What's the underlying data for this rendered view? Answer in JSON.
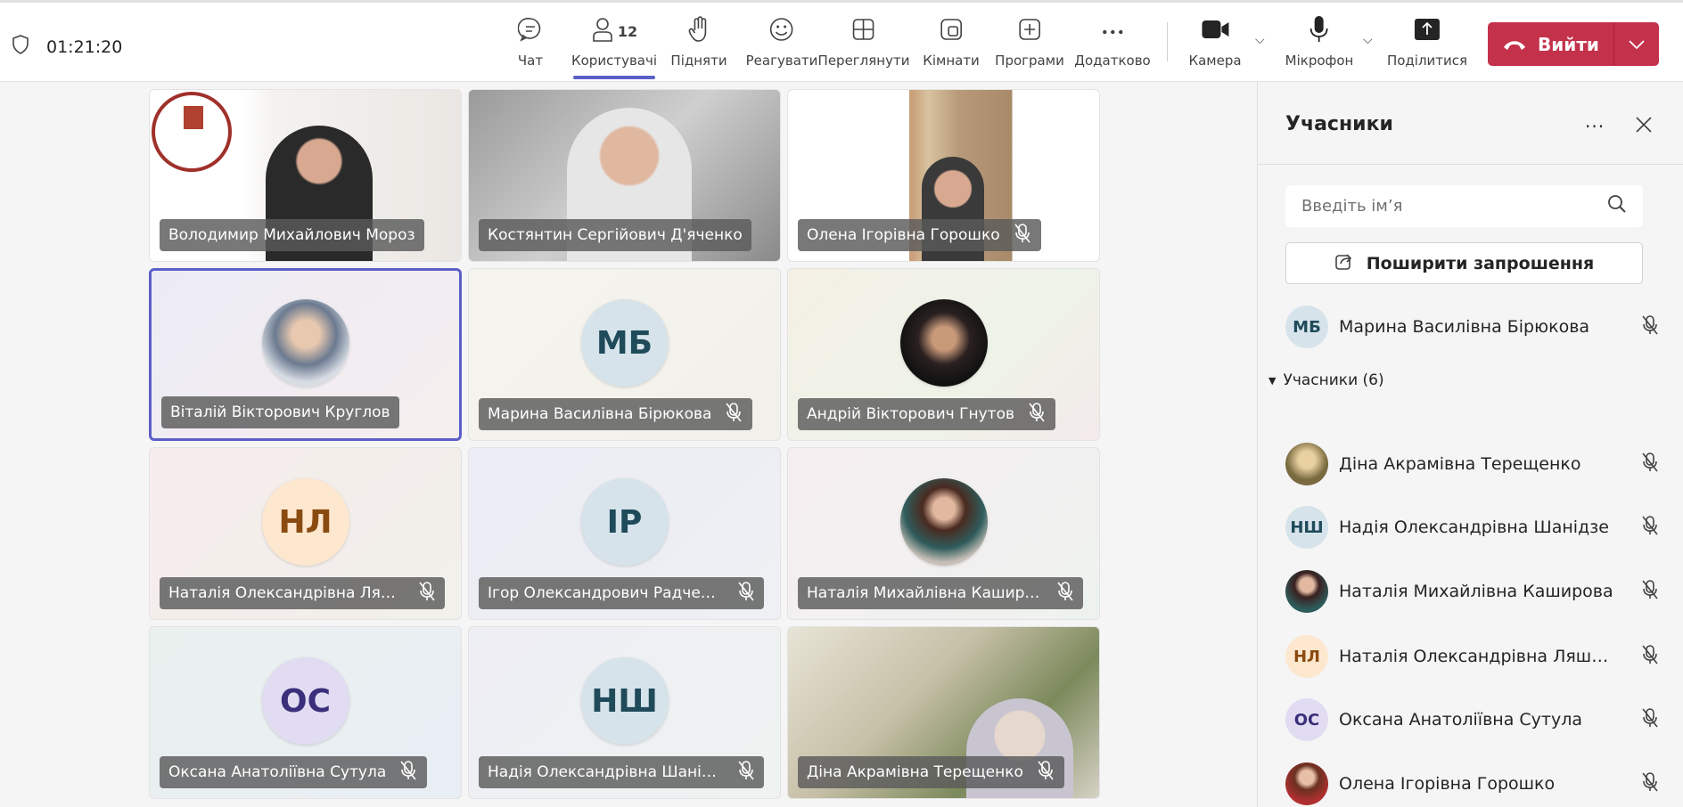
{
  "call": {
    "timer": "01:21:20"
  },
  "toolbar": [
    {
      "id": "chat",
      "label": "Чат",
      "icon": "chat-icon"
    },
    {
      "id": "people",
      "label": "Користувачі",
      "icon": "people-icon",
      "count": "12",
      "active": true
    },
    {
      "id": "raise",
      "label": "Підняти",
      "icon": "hand-icon"
    },
    {
      "id": "react",
      "label": "Реагувати",
      "icon": "smile-icon"
    },
    {
      "id": "view",
      "label": "Переглянути",
      "icon": "grid-icon"
    },
    {
      "id": "rooms",
      "label": "Кімнати",
      "icon": "rooms-icon"
    },
    {
      "id": "apps",
      "label": "Програми",
      "icon": "plus-icon"
    },
    {
      "id": "more",
      "label": "Додатково",
      "icon": "more-icon"
    },
    {
      "id": "camera",
      "label": "Камера",
      "icon": "camera-icon"
    },
    {
      "id": "mic",
      "label": "Мікрофон",
      "icon": "mic-icon"
    },
    {
      "id": "share",
      "label": "Поділитися",
      "icon": "share-icon"
    }
  ],
  "leave": {
    "label": "Вийти",
    "color": "#c4314b"
  },
  "tiles": [
    {
      "name": "Володимир Михайлович Мороз",
      "type": "video",
      "muted": false
    },
    {
      "name": "Костянтин Сергійович Д'яченко",
      "type": "video",
      "muted": false
    },
    {
      "name": "Олена Ігорівна Горошко",
      "type": "video",
      "muted": true
    },
    {
      "name": "Віталій Вікторович Круглов",
      "type": "photo",
      "muted": false,
      "active": true
    },
    {
      "name": "Марина Василівна Бірюкова",
      "type": "initials",
      "initials": "МБ",
      "muted": true
    },
    {
      "name": "Андрій Вікторович Гнутов",
      "type": "photo",
      "muted": true
    },
    {
      "name": "Наталія Олександрівна Ляше...",
      "type": "initials",
      "initials": "НЛ",
      "muted": true
    },
    {
      "name": "Ігор Олександрович Радченко",
      "type": "initials",
      "initials": "ІР",
      "muted": true
    },
    {
      "name": "Наталія Михайлівна Каширова",
      "type": "photo",
      "muted": true
    },
    {
      "name": "Оксана Анатоліївна Сутула",
      "type": "initials",
      "initials": "ОС",
      "muted": true
    },
    {
      "name": "Надія Олександрівна Шанідзе",
      "type": "initials",
      "initials": "НШ",
      "muted": true
    },
    {
      "name": "Діна Акрамівна Терещенко",
      "type": "video",
      "muted": true
    }
  ],
  "panel": {
    "title": "Учасники",
    "search_placeholder": "Введіть ім’я",
    "share_label": "Поширити запрошення",
    "top_person": {
      "name": "Марина Василівна Бірюкова",
      "initials": "МБ"
    },
    "section": "Учасники (6)",
    "people": [
      {
        "name": "Діна Акрамівна Терещенко",
        "initials": ""
      },
      {
        "name": "Надія Олександрівна Шанідзе",
        "initials": "НШ"
      },
      {
        "name": "Наталія Михайлівна Каширова",
        "initials": ""
      },
      {
        "name": "Наталія Олександрівна Ляше...",
        "initials": "НЛ"
      },
      {
        "name": "Оксана Анатоліївна Сутула",
        "initials": "ОС"
      },
      {
        "name": "Олена Ігорівна Горошко",
        "initials": ""
      }
    ]
  }
}
